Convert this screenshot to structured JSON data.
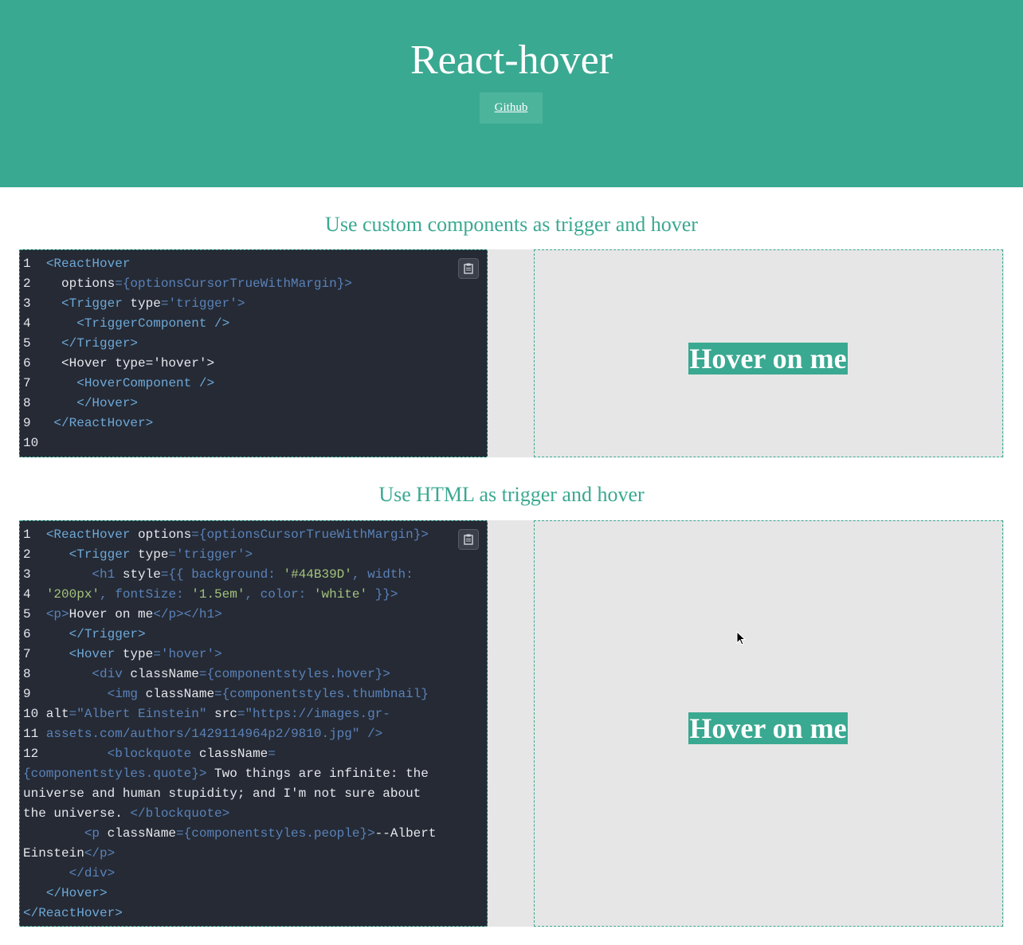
{
  "header": {
    "title": "React-hover",
    "github_label": "Github"
  },
  "sections": [
    {
      "title": "Use custom components as trigger and hover",
      "preview_text": "Hover on me"
    },
    {
      "title": "Use HTML as trigger and hover",
      "preview_text": "Hover on me"
    }
  ],
  "icons": {
    "copy": "clipboard-icon",
    "cursor": "mouse-pointer-icon"
  },
  "colors": {
    "accent": "#3aa991",
    "code_background": "#252a35",
    "preview_background": "#e6e6e6"
  }
}
